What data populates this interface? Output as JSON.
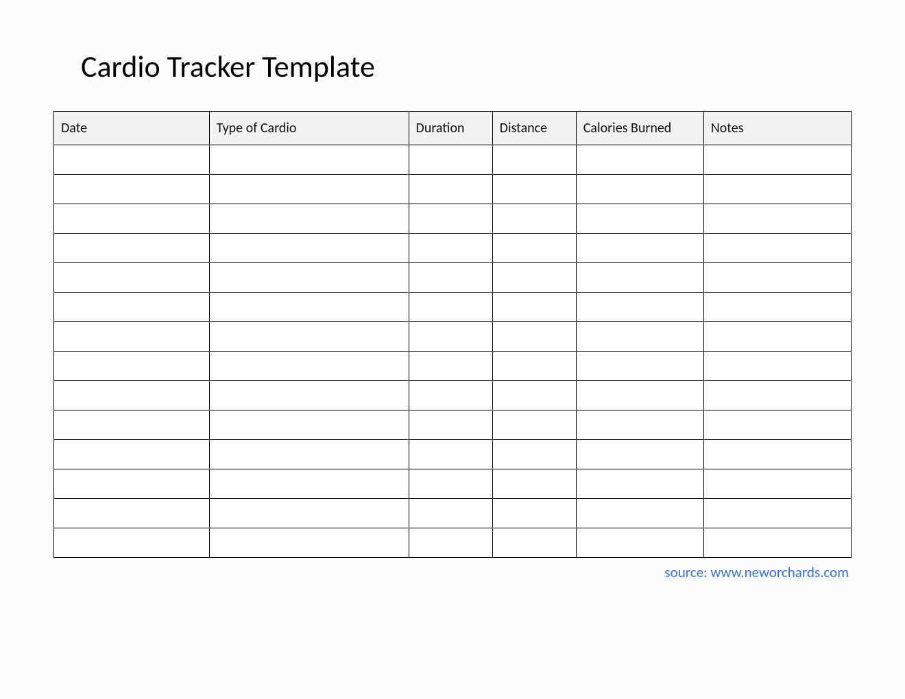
{
  "title": "Cardio Tracker Template",
  "columns": [
    "Date",
    "Type of Cardio",
    "Duration",
    "Distance",
    "Calories Burned",
    "Notes"
  ],
  "rows": [
    [
      "",
      "",
      "",
      "",
      "",
      ""
    ],
    [
      "",
      "",
      "",
      "",
      "",
      ""
    ],
    [
      "",
      "",
      "",
      "",
      "",
      ""
    ],
    [
      "",
      "",
      "",
      "",
      "",
      ""
    ],
    [
      "",
      "",
      "",
      "",
      "",
      ""
    ],
    [
      "",
      "",
      "",
      "",
      "",
      ""
    ],
    [
      "",
      "",
      "",
      "",
      "",
      ""
    ],
    [
      "",
      "",
      "",
      "",
      "",
      ""
    ],
    [
      "",
      "",
      "",
      "",
      "",
      ""
    ],
    [
      "",
      "",
      "",
      "",
      "",
      ""
    ],
    [
      "",
      "",
      "",
      "",
      "",
      ""
    ],
    [
      "",
      "",
      "",
      "",
      "",
      ""
    ],
    [
      "",
      "",
      "",
      "",
      "",
      ""
    ],
    [
      "",
      "",
      "",
      "",
      "",
      ""
    ]
  ],
  "source": "source: www.neworchards.com"
}
